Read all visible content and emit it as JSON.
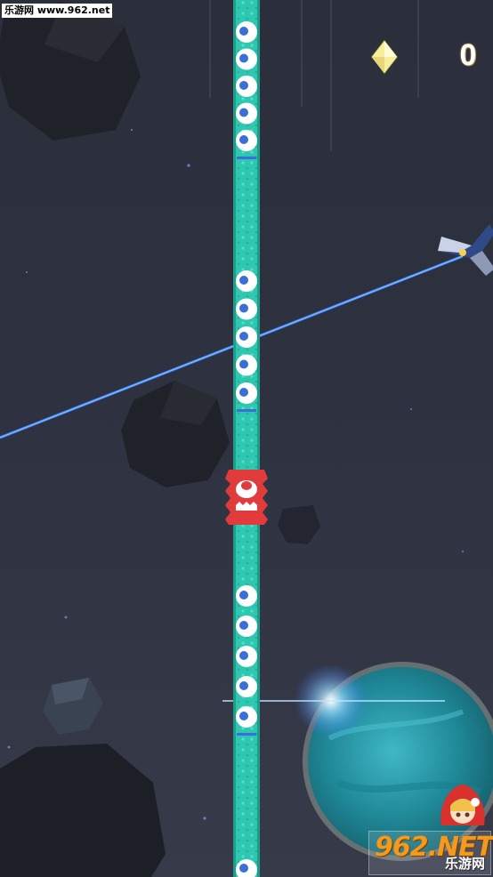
{
  "watermark": {
    "top_text": "乐游网 www.962.net"
  },
  "hud": {
    "score": "0",
    "gem_icon": "diamond-icon",
    "gem_color": "#f7ef9c"
  },
  "logo": {
    "big": "962.NET",
    "small": "乐游网"
  },
  "colors": {
    "pillar": "#2ec7b0",
    "pillar_dots": "#52e0c8",
    "eye_white": "#ffffff",
    "eye_pupil": "#3a6ed8",
    "laser": "#3f86ff",
    "enemy": "#e23b3b",
    "planet": "#2aa6b8"
  },
  "game": {
    "eye_groups": [
      {
        "eyes": 5
      },
      {
        "eyes": 5
      },
      {
        "eyes": 5
      }
    ],
    "enemies": [
      {
        "type": "red-monster"
      }
    ]
  }
}
